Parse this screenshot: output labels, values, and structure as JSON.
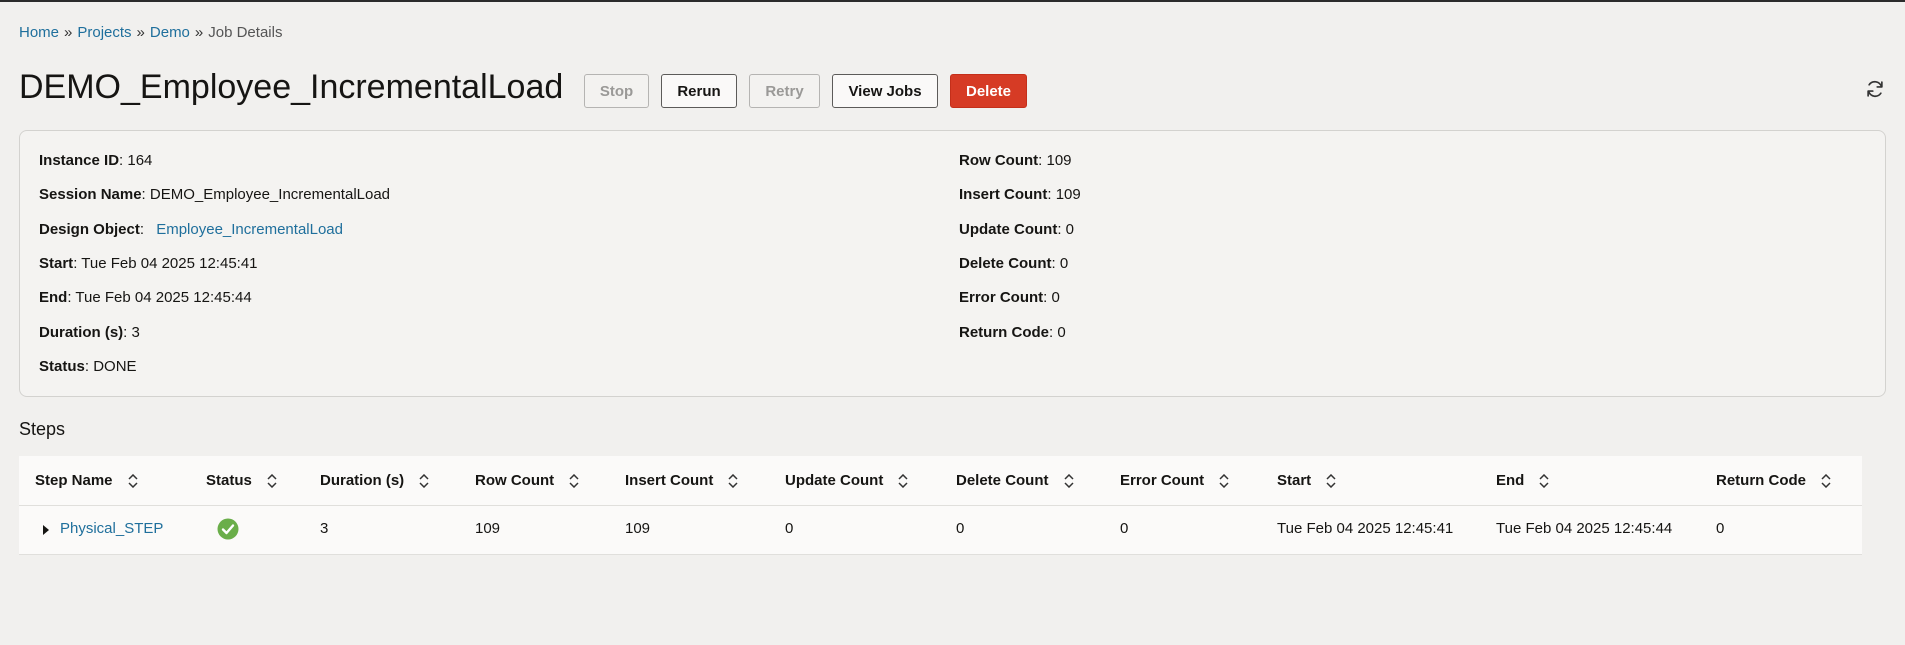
{
  "breadcrumb": {
    "items": [
      "Home",
      "Projects",
      "Demo"
    ],
    "current": "Job Details",
    "separator": "»"
  },
  "page": {
    "title": "DEMO_Employee_IncrementalLoad",
    "refresh_icon": "refresh-icon"
  },
  "toolbar": {
    "stop": "Stop",
    "rerun": "Rerun",
    "retry": "Retry",
    "view_jobs": "View Jobs",
    "delete": "Delete"
  },
  "details": {
    "left": [
      {
        "label": "Instance ID",
        "value": "164"
      },
      {
        "label": "Session Name",
        "value": "DEMO_Employee_IncrementalLoad"
      },
      {
        "label": "Design Object",
        "value": "Employee_IncrementalLoad"
      },
      {
        "label": "Start",
        "value": "Tue Feb 04 2025 12:45:41"
      },
      {
        "label": "End",
        "value": "Tue Feb 04 2025 12:45:44"
      },
      {
        "label": "Duration (s)",
        "value": "3"
      },
      {
        "label": "Status",
        "value": "DONE"
      }
    ],
    "right": [
      {
        "label": "Row Count",
        "value": "109"
      },
      {
        "label": "Insert Count",
        "value": "109"
      },
      {
        "label": "Update Count",
        "value": "0"
      },
      {
        "label": "Delete Count",
        "value": "0"
      },
      {
        "label": "Error Count",
        "value": "0"
      },
      {
        "label": "Return Code",
        "value": "0"
      }
    ]
  },
  "steps": {
    "title": "Steps",
    "columns": [
      "Step Name",
      "Status",
      "Duration (s)",
      "Row Count",
      "Insert Count",
      "Update Count",
      "Delete Count",
      "Error Count",
      "Start",
      "End",
      "Return Code"
    ],
    "rows": [
      {
        "step_name": "Physical_STEP",
        "status_icon": "check-circle-icon",
        "duration": "3",
        "row_count": "109",
        "insert_count": "109",
        "update_count": "0",
        "delete_count": "0",
        "error_count": "0",
        "start": "Tue Feb 04 2025 12:45:41",
        "end": "Tue Feb 04 2025 12:45:44",
        "return_code": "0"
      }
    ]
  },
  "colors": {
    "link": "#1f6f9c",
    "danger": "#d63b25",
    "success": "#6aae4a",
    "background": "#f1f0ee"
  }
}
